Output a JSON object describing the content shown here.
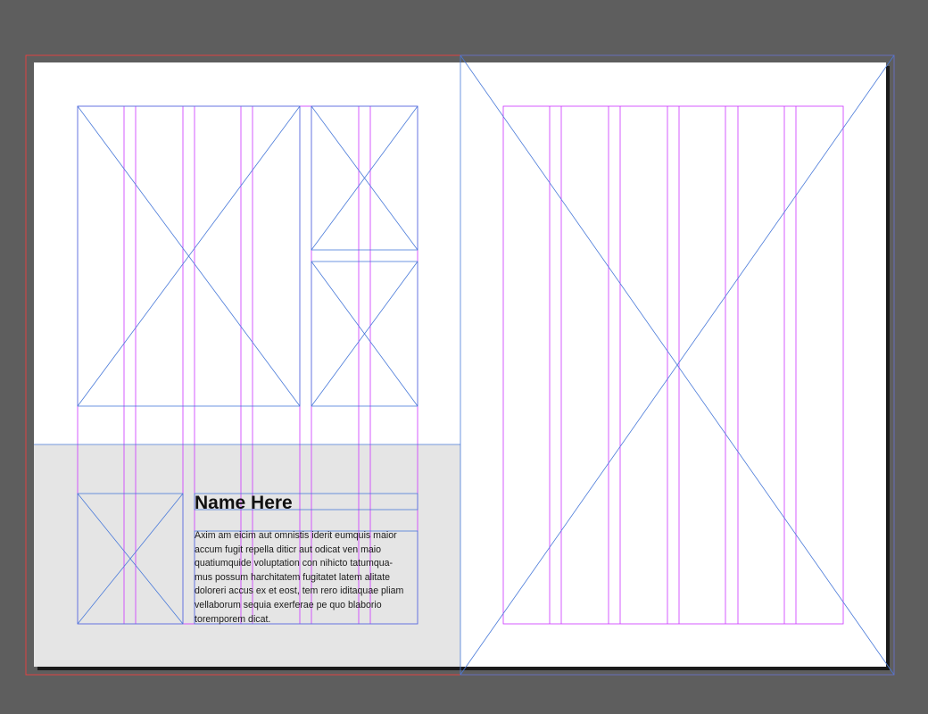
{
  "document": {
    "left_page": {
      "heading": "Name Here",
      "body_lines": [
        "Axim am eicim aut omnistis iderit eumquis maior",
        "accum fugit repella diticr aut odicat ven maio",
        "quatiumquide voluptation con nihicto tatumqua-",
        "mus possum harchitatem fugitatet latem alitate",
        "doloreri accus ex et eost, tem rero iditaquae pliam",
        "vellaborum sequia exerferae pe quo blaborio",
        "toremporem dicat."
      ]
    }
  },
  "colors": {
    "pasteboard": "#5e5e5e",
    "page": "#ffffff",
    "panel_fill": "#e5e5e5",
    "margin_guides": "#cc33ff",
    "frame_lines": "#4a7ad9",
    "bleed_guide": "#ff3b3b",
    "text": "#111111"
  }
}
